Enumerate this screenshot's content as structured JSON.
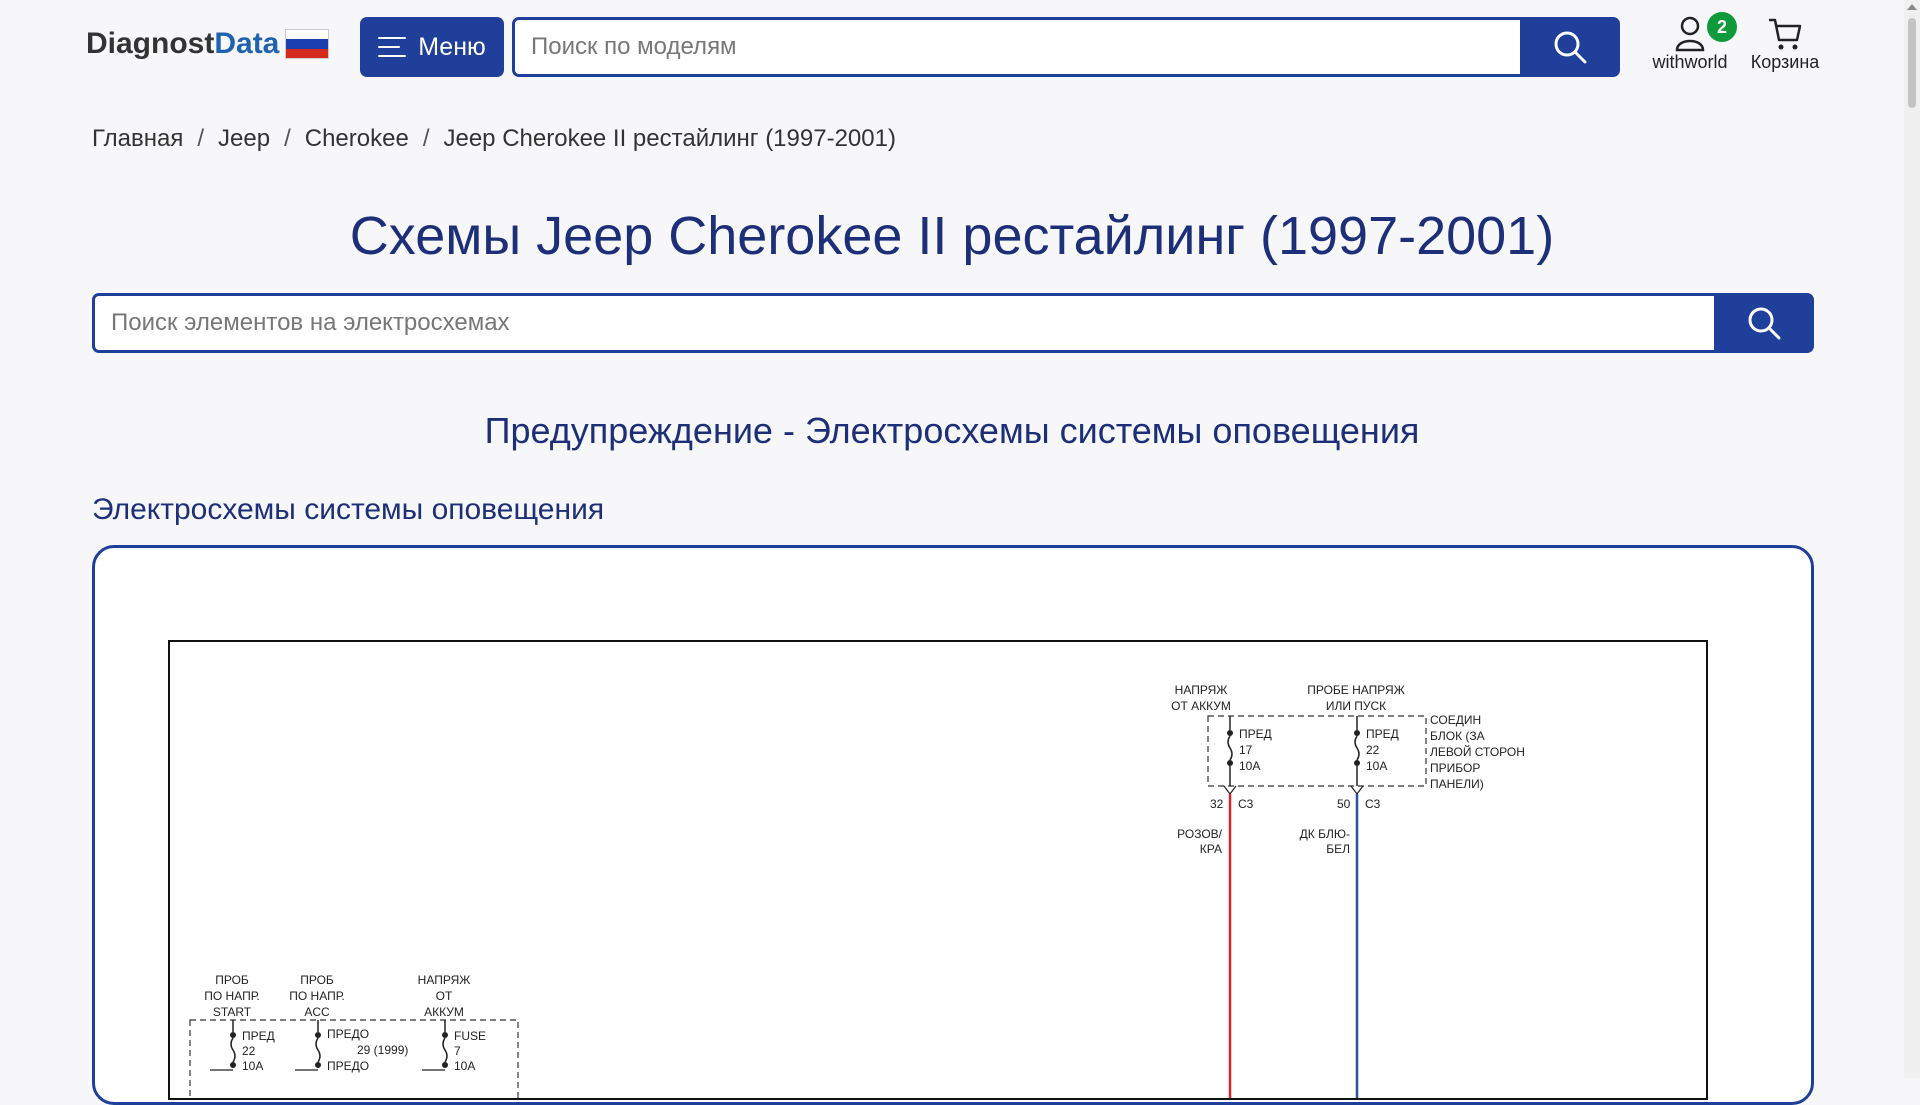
{
  "header": {
    "logo_part1": "Diagnost",
    "logo_part2": "Data",
    "flag_colors": [
      "#ffffff",
      "#1b3fb0",
      "#d52b1e"
    ],
    "menu_label": "Меню",
    "search_placeholder": "Поиск по моделям",
    "user_name": "withworld",
    "notification_count": "2",
    "cart_label": "Корзина"
  },
  "breadcrumb": [
    {
      "label": "Главная"
    },
    {
      "label": "Jeep"
    },
    {
      "label": "Cherokee"
    },
    {
      "label": "Jeep Cherokee II рестайлинг (1997-2001)"
    }
  ],
  "breadcrumb_sep": "/",
  "page_title": "Схемы Jeep Cherokee II рестайлинг (1997-2001)",
  "element_search_placeholder": "Поиск элементов на электросхемах",
  "section_heading": "Предупреждение - Электросхемы системы оповещения",
  "sub_heading": "Электросхемы системы оповещения",
  "diagram": {
    "top_labels": {
      "batt_feed_1": "НАПРЯЖ",
      "batt_feed_2": "ОТ АККУМ",
      "run_feed_1": "ПРОБЕ НАПРЯЖ",
      "run_feed_2": "ИЛИ ПУСК",
      "junction_1": "СОЕДИН",
      "junction_2": "БЛОК (ЗА",
      "junction_3": "ЛЕВОЙ СТОРОН",
      "junction_4": "ПРИБОР",
      "junction_5": "ПАНЕЛИ)",
      "fuse_a_1": "ПРЕД",
      "fuse_a_2": "17",
      "fuse_a_3": "10А",
      "fuse_b_1": "ПРЕД",
      "fuse_b_2": "22",
      "fuse_b_3": "10А",
      "pin_a": "32",
      "conn_a": "C3",
      "pin_b": "50",
      "conn_b": "C3",
      "wire_a_1": "РОЗОВ/",
      "wire_a_2": "КРА",
      "wire_b_1": "ДК БЛЮ-",
      "wire_b_2": "БЕЛ"
    },
    "bottom_labels": {
      "start_1": "ПРОБ",
      "start_2": "ПО НАПР.",
      "start_3": "START",
      "acc_1": "ПРОБ",
      "acc_2": "ПО НАПР.",
      "acc_3": "ACC",
      "batt_1": "НАПРЯЖ",
      "batt_2": "ОТ",
      "batt_3": "АККУМ",
      "f1_1": "ПРЕД",
      "f1_2": "22",
      "f1_3": "10А",
      "f2_1": "ПРЕДО",
      "f2_2": "29 (1999)",
      "f2_3": "ПРЕДО",
      "f3_1": "FUSE",
      "f3_2": "7",
      "f3_3": "10А"
    },
    "wire_colors": {
      "red": "#d62828",
      "blue": "#2a4fa8"
    }
  },
  "colors": {
    "primary": "#1f3f9a",
    "badge": "#0e9a3a"
  }
}
